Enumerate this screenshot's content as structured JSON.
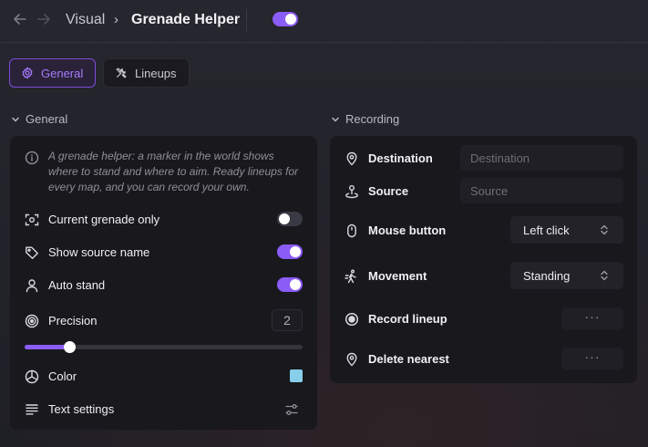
{
  "header": {
    "breadcrumb_parent": "Visual",
    "breadcrumb_separator": "›",
    "title": "Grenade Helper",
    "enabled": true
  },
  "tabs": [
    {
      "label": "General",
      "active": true,
      "icon": "gear-icon"
    },
    {
      "label": "Lineups",
      "active": false,
      "icon": "tools-icon"
    }
  ],
  "general": {
    "section_title": "General",
    "info": "A grenade helper: a marker in the world shows where to stand and where to aim. Ready lineups for every map, and you can record your own.",
    "current_grenade_only": {
      "label": "Current grenade only",
      "enabled": false
    },
    "show_source_name": {
      "label": "Show source name",
      "enabled": true
    },
    "auto_stand": {
      "label": "Auto stand",
      "enabled": true
    },
    "precision": {
      "label": "Precision",
      "value": "2",
      "slider_fraction": 0.16
    },
    "color": {
      "label": "Color",
      "value": "#87cfe9"
    },
    "text_settings": {
      "label": "Text settings"
    }
  },
  "recording": {
    "section_title": "Recording",
    "destination": {
      "label": "Destination",
      "value": "",
      "placeholder": "Destination"
    },
    "source": {
      "label": "Source",
      "value": "",
      "placeholder": "Source"
    },
    "mouse_button": {
      "label": "Mouse button",
      "value": "Left click"
    },
    "movement": {
      "label": "Movement",
      "value": "Standing"
    },
    "record_lineup": {
      "label": "Record lineup",
      "button": "···"
    },
    "delete_nearest": {
      "label": "Delete nearest",
      "button": "···"
    }
  },
  "colors": {
    "accent": "#8b5cf6",
    "card": "#18181d",
    "background": "#23232a"
  }
}
